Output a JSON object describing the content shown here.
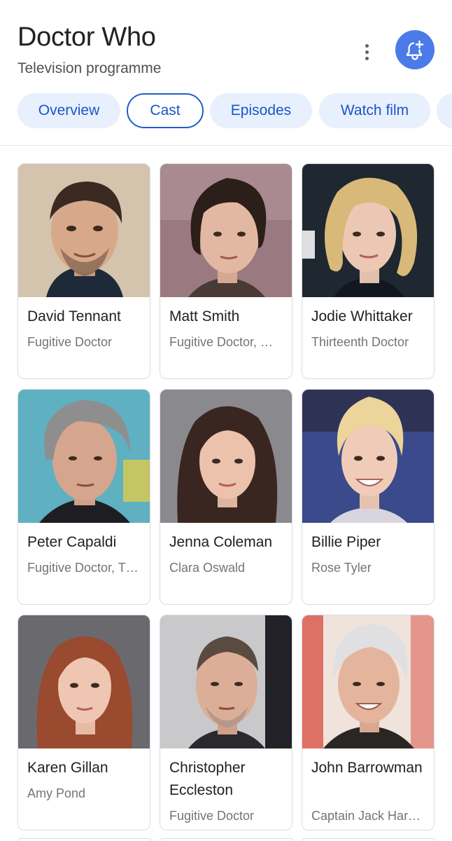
{
  "header": {
    "title": "Doctor Who",
    "subtitle": "Television programme"
  },
  "tabs": [
    {
      "label": "Overview",
      "active": false
    },
    {
      "label": "Cast",
      "active": true
    },
    {
      "label": "Episodes",
      "active": false
    },
    {
      "label": "Watch film",
      "active": false
    },
    {
      "label": "",
      "active": false
    }
  ],
  "cast": [
    {
      "name": "David Tennant",
      "role": "Fugitive Doctor"
    },
    {
      "name": "Matt Smith",
      "role": "Fugitive Doctor, …"
    },
    {
      "name": "Jodie Whittaker",
      "role": "Thirteenth Doctor"
    },
    {
      "name": "Peter Capaldi",
      "role": "Fugitive Doctor, T…"
    },
    {
      "name": "Jenna Coleman",
      "role": "Clara Oswald"
    },
    {
      "name": "Billie Piper",
      "role": "Rose Tyler"
    },
    {
      "name": "Karen Gillan",
      "role": "Amy Pond"
    },
    {
      "name": "Christopher Eccleston",
      "role": "Fugitive Doctor"
    },
    {
      "name": "John Barrowman",
      "role": "Captain Jack Har…"
    }
  ],
  "colors": {
    "accent": "#4a7be8",
    "tab_bg": "#e8f0fe",
    "tab_text": "#1a56c4"
  },
  "icons": {
    "more": "more-vert-icon",
    "follow": "bell-plus-icon"
  }
}
